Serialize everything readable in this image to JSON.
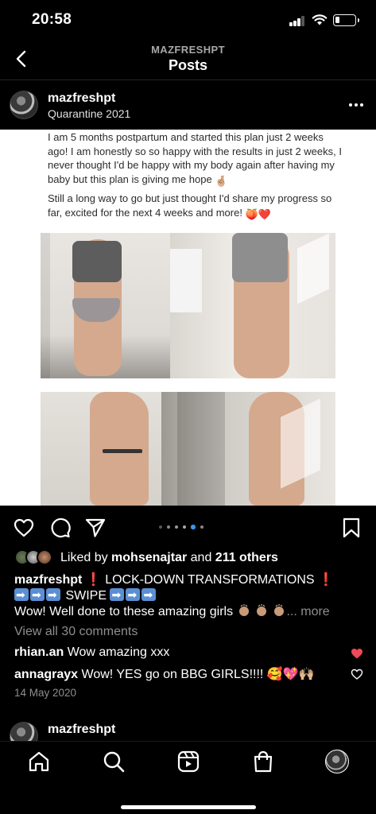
{
  "status": {
    "time": "20:58"
  },
  "header": {
    "subtitle": "MAZFRESHPT",
    "title": "Posts"
  },
  "post": {
    "username": "mazfreshpt",
    "location": "Quarantine 2021",
    "image_caption": {
      "para1": "I am 5 months postpartum and started this plan just 2 weeks ago! I am honestly so so happy with the results in just 2 weeks, I never thought I'd be happy with my body again after having my baby but this plan is giving me hope",
      "para1_emoji": "🤞🏼",
      "para2": "Still a long way to go but just thought I'd share my progress so far, excited for the next 4 weeks and more!",
      "para2_emoji": "🍑❤️"
    },
    "carousel": {
      "total": 6,
      "active_index": 4
    },
    "likes": {
      "prefix": "Liked by",
      "user": "mohsenajtar",
      "connector": "and",
      "others": "211 others"
    },
    "caption": {
      "username": "mazfreshpt",
      "headline": "LOCK-DOWN TRANSFORMATIONS",
      "excl": "❗",
      "swipe": "SWIPE",
      "body": "Wow! Well done to these amazing girls",
      "more": "... more"
    },
    "view_comments": "View all 30 comments",
    "comments": [
      {
        "user": "rhian.an",
        "text": "Wow amazing xxx",
        "liked": true
      },
      {
        "user": "annagrayx",
        "text": "Wow! YES go on BBG GIRLS!!!!",
        "emoji": "🥰💖🙌🏼",
        "liked": false
      }
    ],
    "date": "14 May 2020"
  },
  "next_post": {
    "username": "mazfreshpt"
  },
  "colors": {
    "like_red": "#ed4956",
    "dot_active": "#3897f0",
    "muted": "#8e8e8e"
  },
  "nav": {
    "items": [
      "home-icon",
      "search-icon",
      "reels-icon",
      "shop-icon",
      "profile-avatar"
    ]
  }
}
